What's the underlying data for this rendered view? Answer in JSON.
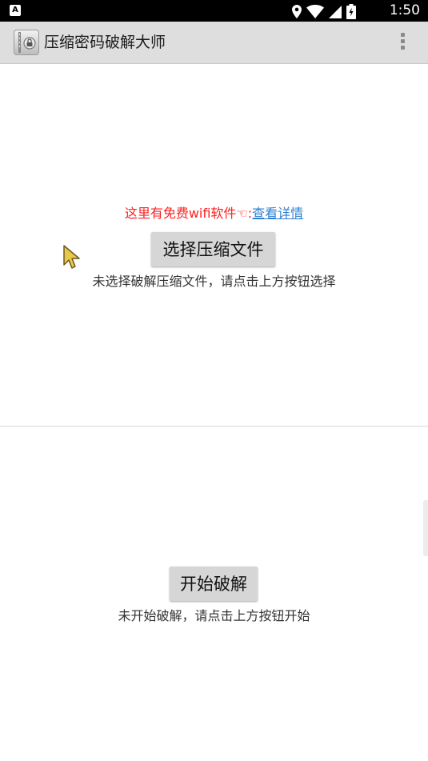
{
  "status_bar": {
    "notification_icon": "A",
    "icons": [
      "location-icon",
      "wifi-icon",
      "signal-icon",
      "battery-icon"
    ],
    "time": "1:50"
  },
  "toolbar": {
    "title": "压缩密码破解大师",
    "app_icon": "zip-lock-icon",
    "menu_icon": "overflow-menu-icon"
  },
  "main": {
    "promo_text": "这里有免费wifi软件☜:",
    "promo_link": "查看详情",
    "select_button_label": "选择压缩文件",
    "select_hint": "未选择破解压缩文件，请点击上方按钮选择",
    "start_button_label": "开始破解",
    "start_hint": "未开始破解，请点击上方按钮开始"
  },
  "colors": {
    "promo_text": "#ff1f1f",
    "promo_link": "#2f7fd1",
    "toolbar_bg": "#dedede",
    "button_bg": "#d6d6d6"
  }
}
